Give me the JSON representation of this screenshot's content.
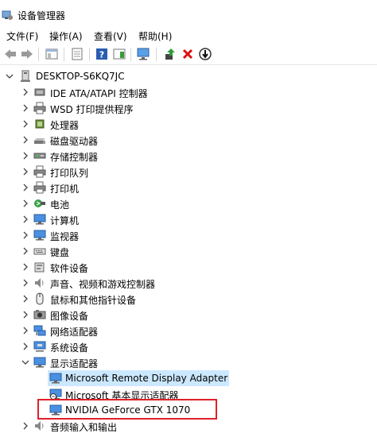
{
  "window": {
    "title": "设备管理器"
  },
  "menu": [
    "文件(F)",
    "操作(A)",
    "查看(V)",
    "帮助(H)"
  ],
  "tree": {
    "root": "DESKTOP-S6KQ7JC",
    "categories": [
      {
        "label": "IDE ATA/ATAPI 控制器",
        "icon": "ide-controller-icon"
      },
      {
        "label": "WSD 打印提供程序",
        "icon": "printer-icon"
      },
      {
        "label": "处理器",
        "icon": "processor-icon"
      },
      {
        "label": "磁盘驱动器",
        "icon": "disk-drive-icon"
      },
      {
        "label": "存储控制器",
        "icon": "storage-controller-icon"
      },
      {
        "label": "打印队列",
        "icon": "printer-icon"
      },
      {
        "label": "打印机",
        "icon": "printer-icon"
      },
      {
        "label": "电池",
        "icon": "battery-icon"
      },
      {
        "label": "计算机",
        "icon": "computer-icon"
      },
      {
        "label": "监视器",
        "icon": "monitor-icon"
      },
      {
        "label": "键盘",
        "icon": "keyboard-icon"
      },
      {
        "label": "软件设备",
        "icon": "software-device-icon"
      },
      {
        "label": "声音、视频和游戏控制器",
        "icon": "speaker-icon"
      },
      {
        "label": "鼠标和其他指针设备",
        "icon": "mouse-icon"
      },
      {
        "label": "图像设备",
        "icon": "camera-icon"
      },
      {
        "label": "网络适配器",
        "icon": "network-adapter-icon"
      },
      {
        "label": "系统设备",
        "icon": "system-device-icon"
      }
    ],
    "display_adapters": {
      "label": "显示适配器",
      "children": [
        {
          "label": "Microsoft Remote Display Adapter",
          "selected": true
        },
        {
          "label": "Microsoft 基本显示适配器",
          "selected": false
        },
        {
          "label": "NVIDIA GeForce GTX 1070",
          "selected": false
        }
      ]
    },
    "last_category": "音频输入和输出"
  },
  "colors": {
    "selection": "#cce8ff",
    "highlight_border": "#e0202a",
    "monitor_blue": "#2b7bd6"
  }
}
